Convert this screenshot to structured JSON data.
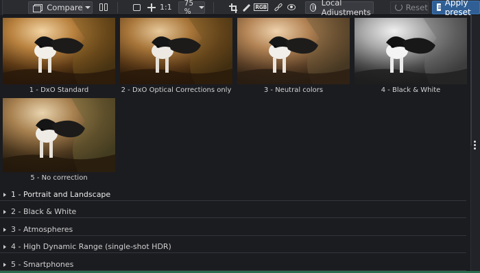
{
  "toolbar": {
    "compare_label": "Compare",
    "one_to_one_label": "1:1",
    "zoom_value": "75 %",
    "rgb_label": "RGB",
    "local_adjustments_label": "Local Adjustments",
    "reset_label": "Reset",
    "apply_preset_label": "Apply preset"
  },
  "colors": {
    "background": "#1b1c20",
    "toolbar": "#2b2c30",
    "accent_blue": "#2f5f95",
    "status_green": "#2c6b4e"
  },
  "thumbnails": [
    {
      "caption": "1 - DxO Standard",
      "style": "standard"
    },
    {
      "caption": "2 - DxO Optical Corrections only",
      "style": "optical"
    },
    {
      "caption": "3 - Neutral colors",
      "style": "neutral"
    },
    {
      "caption": "4 - Black & White",
      "style": "bw"
    },
    {
      "caption": "5 - No correction",
      "style": "none"
    }
  ],
  "categories": [
    {
      "label": "1 - Portrait and Landscape"
    },
    {
      "label": "2 - Black & White"
    },
    {
      "label": "3 - Atmospheres"
    },
    {
      "label": "4 - High Dynamic Range (single-shot HDR)"
    },
    {
      "label": "5 - Smartphones"
    }
  ],
  "icons": {
    "compare": "compare-icon",
    "split_view": "split-view-icon",
    "fit": "fit-screen-icon",
    "move": "move-icon",
    "crop": "crop-icon",
    "picker": "eyedropper-icon",
    "rgb": "rgb-icon",
    "repair": "repair-icon",
    "eye": "eye-icon",
    "local": "local-adjustments-icon",
    "reset": "reset-icon",
    "apply": "apply-preset-icon"
  }
}
